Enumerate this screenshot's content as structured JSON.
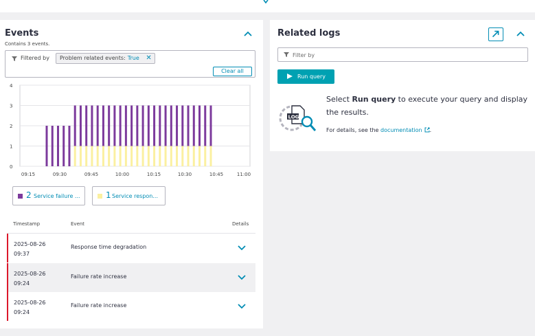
{
  "colors": {
    "accent": "#008cb4",
    "run_button": "#00a1b2",
    "service_failure": "#7c3a9c",
    "service_response": "#fbf0a0",
    "severity_bar": "#dc172a"
  },
  "events_panel": {
    "title": "Events",
    "subtitle": "Contains 3 events.",
    "filter": {
      "label": "Filtered by",
      "chip_key": "Problem related events:",
      "chip_value": "True",
      "clear_label": "Clear all"
    },
    "legend": [
      {
        "count": "2",
        "label": "Service failure ...",
        "color": "#7c3a9c"
      },
      {
        "count": "1",
        "label": "Service respon...",
        "color": "#fbf0a0"
      }
    ],
    "table": {
      "headers": {
        "timestamp": "Timestamp",
        "event": "Event",
        "details": "Details"
      },
      "rows": [
        {
          "date": "2025-08-26",
          "time": "09:37",
          "event": "Response time degradation"
        },
        {
          "date": "2025-08-26",
          "time": "09:24",
          "event": "Failure rate increase"
        },
        {
          "date": "2025-08-26",
          "time": "09:24",
          "event": "Failure rate increase"
        }
      ]
    }
  },
  "logs_panel": {
    "title": "Related logs",
    "filter_placeholder": "Filter by",
    "run_label": "Run query",
    "message_pre": "Select ",
    "message_bold": "Run query",
    "message_post": " to execute your query and display the results.",
    "detail_pre": "For details, see the ",
    "detail_link": "documentation",
    "detail_post": "."
  },
  "icons": [
    "caret-down-icon",
    "chevron-up-icon",
    "filter-icon",
    "close-icon",
    "chevron-down-icon",
    "open-external-icon",
    "play-icon",
    "log-search-icon",
    "external-link-icon"
  ],
  "chart_data": {
    "type": "bar",
    "stacked": true,
    "y_ticks": [
      "4",
      "3",
      "2",
      "1",
      "0"
    ],
    "ylim": [
      0,
      4
    ],
    "x_ticks": [
      "09:15",
      "09:30",
      "09:45",
      "10:00",
      "10:15",
      "10:30",
      "10:45",
      "11:00"
    ],
    "series": [
      {
        "name": "Service failure",
        "color": "#7c3a9c",
        "values": [
          2,
          2,
          2,
          2,
          2,
          2,
          2,
          2,
          2,
          2,
          2,
          2,
          2,
          2,
          2,
          2,
          2,
          2,
          2,
          2,
          2,
          2,
          2,
          2,
          2,
          2,
          2,
          2,
          2,
          2
        ]
      },
      {
        "name": "Service response",
        "color": "#fbf0a0",
        "values": [
          0,
          0,
          0,
          0,
          0,
          1,
          1,
          1,
          1,
          1,
          1,
          1,
          1,
          1,
          1,
          1,
          1,
          1,
          1,
          1,
          1,
          1,
          1,
          1,
          1,
          1,
          1,
          1,
          1,
          1
        ]
      }
    ]
  }
}
